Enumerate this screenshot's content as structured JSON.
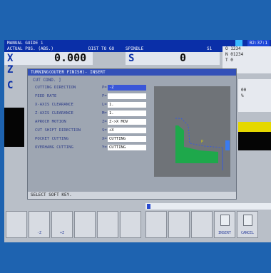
{
  "header": {
    "mode": "MANUAL GUIDE i",
    "time": "02:37:1"
  },
  "position_bar": {
    "actual_pos": "ACTUAL POS. (ABS.)",
    "dist_to_go": "DIST TO GO",
    "spindle": "SPINDLE",
    "spindle_no": "S1"
  },
  "axes": {
    "x": "X",
    "z": "Z",
    "c": "C",
    "x_value": "0.000",
    "s": "S",
    "s_value": "0"
  },
  "info_panel": {
    "line1": "O 1234",
    "line2": "N 01234",
    "line3": "T 0"
  },
  "side_panel": {
    "line1": "00",
    "line2": "%"
  },
  "dialog": {
    "title": "TURNING(OUTER FINISH)- INSERT",
    "section": "CUT COND. ]",
    "rows": [
      {
        "label": "CUTTING DIRECTION",
        "key": "P=",
        "value": "-Z",
        "selected": true
      },
      {
        "label": "FEED RATE",
        "key": "F=",
        "value": ""
      },
      {
        "label": "X-AXIS CLEARANCE",
        "key": "L=",
        "value": "1."
      },
      {
        "label": "Z-AXIS CLEARANCE",
        "key": "M=",
        "value": "1."
      },
      {
        "label": "APROCH MOTION",
        "key": "Z=",
        "value": "Z->X MOV"
      },
      {
        "label": "CUT SHIFT DIRECTION",
        "key": "S=",
        "value": "+X"
      },
      {
        "label": "POCKET CUTTING",
        "key": "X=",
        "value": "CUTTING"
      },
      {
        "label": "OVERHANG CUTTING",
        "key": "Y=",
        "value": "CUTTING"
      }
    ],
    "message": "SELECT SOFT KEY."
  },
  "softkeys": {
    "k2": "-Z",
    "k3": "+Z",
    "insert": "INSERT",
    "cancel": "CANCEL"
  },
  "colors": {
    "screen_bg": "#1e63b0",
    "header_bg": "#0a2fa8",
    "selected_field": "#3a56d8",
    "preview_part": "#1ea84b"
  }
}
